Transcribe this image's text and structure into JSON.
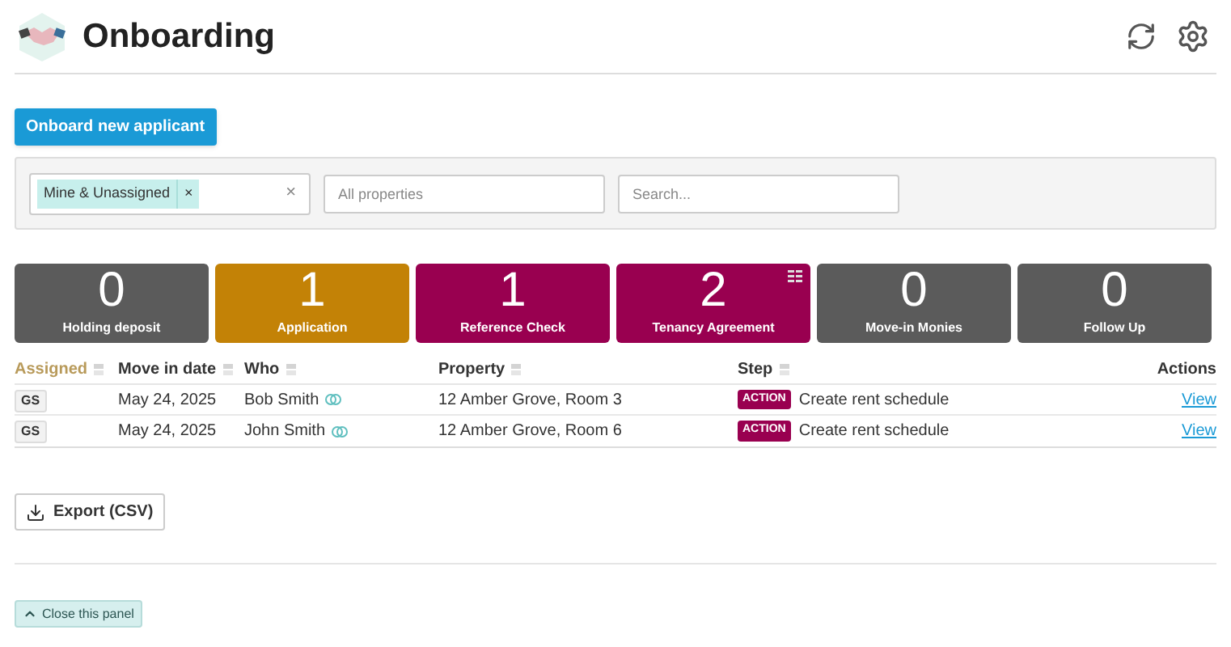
{
  "header": {
    "title": "Onboarding"
  },
  "new_button": "Onboard new applicant",
  "filters": {
    "tag": "Mine & Unassigned",
    "tag_remove": "×",
    "clear": "×",
    "property_placeholder": "All properties",
    "search_placeholder": "Search..."
  },
  "tiles": [
    {
      "count": "0",
      "label": "Holding deposit",
      "color": "#5b5b5b",
      "selected": false
    },
    {
      "count": "1",
      "label": "Application",
      "color": "#c38206",
      "selected": false
    },
    {
      "count": "1",
      "label": "Reference Check",
      "color": "#990050",
      "selected": false
    },
    {
      "count": "2",
      "label": "Tenancy Agreement",
      "color": "#990050",
      "selected": true
    },
    {
      "count": "0",
      "label": "Move-in Monies",
      "color": "#5b5b5b",
      "selected": false
    },
    {
      "count": "0",
      "label": "Follow Up",
      "color": "#5b5b5b",
      "selected": false
    }
  ],
  "table": {
    "columns": [
      {
        "label": "Assigned",
        "selected": true,
        "sortable": true
      },
      {
        "label": "Move in date",
        "selected": false,
        "sortable": true
      },
      {
        "label": "Who",
        "selected": false,
        "sortable": true
      },
      {
        "label": "Property",
        "selected": false,
        "sortable": true
      },
      {
        "label": "Step",
        "selected": false,
        "sortable": true
      },
      {
        "label": "Actions",
        "selected": false,
        "sortable": false
      }
    ],
    "rows": [
      {
        "assigned": "GS",
        "move_in": "May 24, 2025",
        "who": "Bob Smith",
        "property": "12 Amber Grove, Room 3",
        "badge": "ACTION",
        "step": "Create rent schedule",
        "action": "View"
      },
      {
        "assigned": "GS",
        "move_in": "May 24, 2025",
        "who": "John Smith",
        "property": "12 Amber Grove, Room 6",
        "badge": "ACTION",
        "step": "Create rent schedule",
        "action": "View"
      }
    ]
  },
  "export_button": "Export (CSV)",
  "close_button": "Close this panel"
}
